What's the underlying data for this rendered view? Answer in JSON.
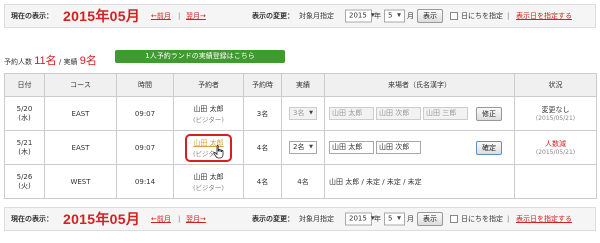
{
  "nav": {
    "current_label": "現在の表示：",
    "current_month": "2015年05月",
    "prev_link": "←前月",
    "separator": "|",
    "next_link": "翌月→",
    "change_label": "表示の変更：",
    "target_label": "対象月指定",
    "year_value": "2015",
    "year_unit": "年",
    "month_value": "5",
    "month_unit": "月",
    "show_button": "表示",
    "day_check_label": "日にちを指定",
    "show_date_link": "表示日を指定する"
  },
  "summary": {
    "reserved_label": "予約人数",
    "reserved_value": "11名",
    "slash": "/",
    "actual_label": "実績",
    "actual_value": "9名",
    "banner": "1人予約ランドの実績登録はこちら"
  },
  "table": {
    "headers": [
      "日付",
      "コース",
      "時間",
      "予約者",
      "予約時",
      "実績",
      "来場者（氏名漢字）",
      "状況"
    ],
    "rows": [
      {
        "date": "5/20",
        "weekday": "(水)",
        "course": "EAST",
        "time": "09:07",
        "booker": "山田 太郎",
        "booker_sub": "(ビジター)",
        "reserved": "3名",
        "actual": "3名",
        "visitors": [
          "山田 太郎",
          "山田 次郎",
          "山田 三郎"
        ],
        "button": "修正",
        "status": "変更なし",
        "status_date": "(2015/05/21)"
      },
      {
        "date": "5/21",
        "weekday": "(木)",
        "course": "EAST",
        "time": "09:07",
        "booker": "山田 太郎",
        "booker_sub": "(ビジター)",
        "reserved": "4名",
        "actual": "2名",
        "visitors": [
          "山田 太郎",
          "山田 次郎"
        ],
        "button": "確定",
        "status": "人数減",
        "status_date": "(2015/05/21)"
      },
      {
        "date": "5/26",
        "weekday": "(火)",
        "course": "WEST",
        "time": "09:14",
        "booker": "山田 太郎",
        "booker_sub": "(ビジター)",
        "reserved": "4名",
        "actual": "4名",
        "visitors_text": "山田 太郎 / 未定 / 未定 / 未定",
        "status": ""
      }
    ]
  },
  "colors": {
    "accent_red": "#d42020",
    "banner_green": "#3f9a2f",
    "link_orange": "#d9a040"
  },
  "icons": [
    "dropdown-arrow-icon",
    "hand-pointer-icon",
    "checkbox-icon"
  ]
}
